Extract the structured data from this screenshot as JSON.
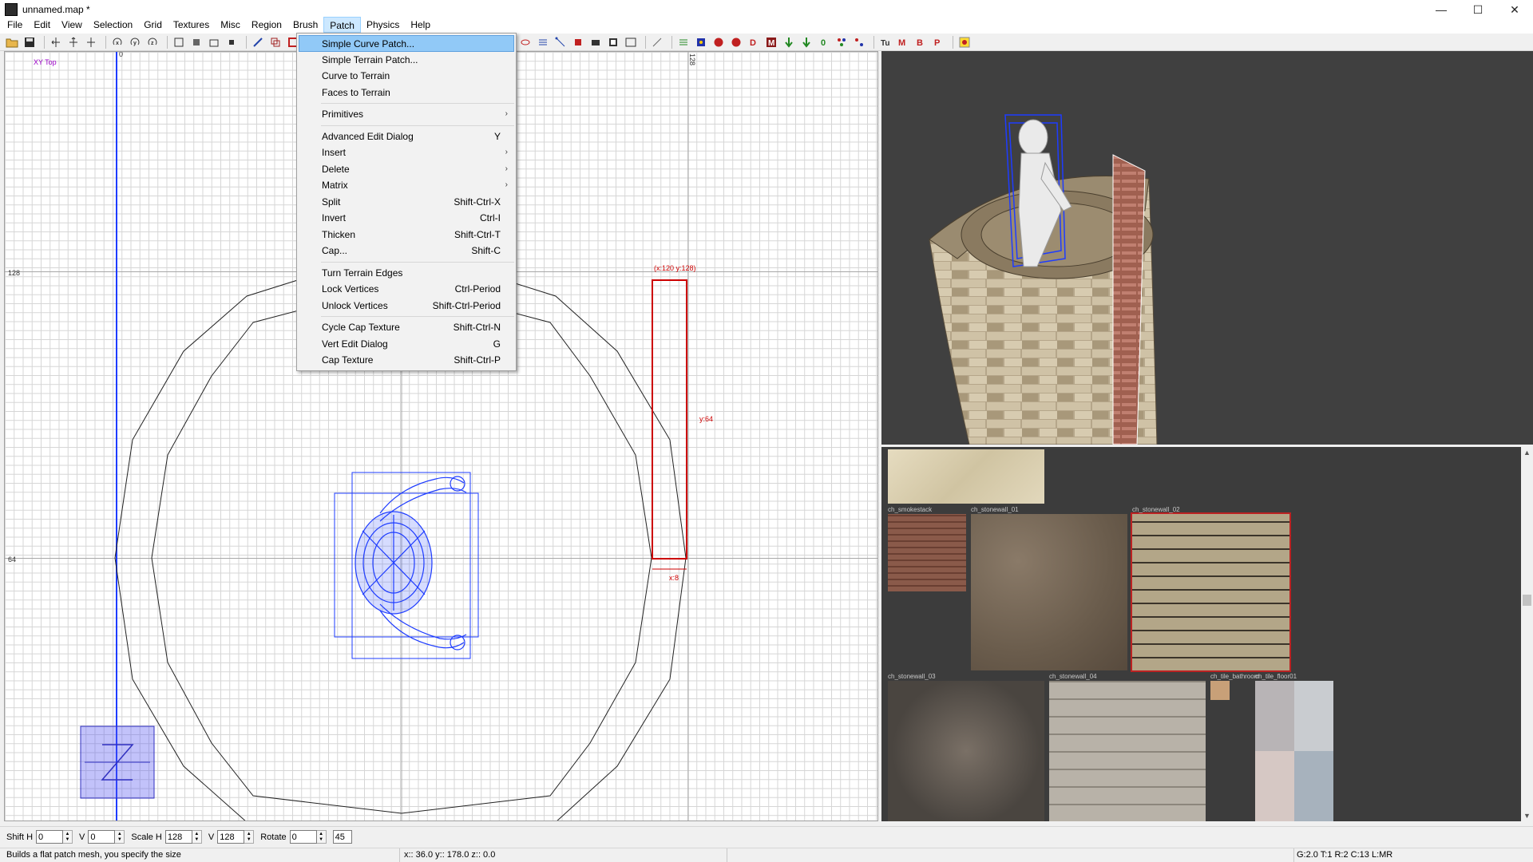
{
  "window": {
    "title": "unnamed.map *",
    "minimize": "—",
    "maximize": "☐",
    "close": "✕"
  },
  "menubar": [
    "File",
    "Edit",
    "View",
    "Selection",
    "Grid",
    "Textures",
    "Misc",
    "Region",
    "Brush",
    "Patch",
    "Physics",
    "Help"
  ],
  "active_menu": "Patch",
  "patch_menu": {
    "simple_curve": "Simple Curve Patch...",
    "simple_terrain": "Simple Terrain Patch...",
    "curve_to_terrain": "Curve to Terrain",
    "faces_to_terrain": "Faces to Terrain",
    "primitives": "Primitives",
    "advanced_edit": "Advanced Edit Dialog",
    "advanced_edit_sc": "Y",
    "insert": "Insert",
    "delete": "Delete",
    "matrix": "Matrix",
    "split": "Split",
    "split_sc": "Shift-Ctrl-X",
    "invert": "Invert",
    "invert_sc": "Ctrl-I",
    "thicken": "Thicken",
    "thicken_sc": "Shift-Ctrl-T",
    "cap": "Cap...",
    "cap_sc": "Shift-C",
    "turn_terrain_edges": "Turn Terrain Edges",
    "lock_vertices": "Lock Vertices",
    "lock_vertices_sc": "Ctrl-Period",
    "unlock_vertices": "Unlock Vertices",
    "unlock_vertices_sc": "Shift-Ctrl-Period",
    "cycle_cap_texture": "Cycle Cap Texture",
    "cycle_cap_texture_sc": "Shift-Ctrl-N",
    "vert_edit_dialog": "Vert Edit Dialog",
    "vert_edit_dialog_sc": "G",
    "cap_texture": "Cap Texture",
    "cap_texture_sc": "Shift-Ctrl-P",
    "submenu_arrow": "›"
  },
  "grid_view": {
    "label": "XY Top",
    "num_128_left": "128",
    "num_64_left": "64",
    "num_128_top": "128",
    "num_0_top": "0",
    "sel_coords": "(x:120  y:128)",
    "sel_y": "y:64",
    "sel_x": "x:8"
  },
  "textures": [
    {
      "name": ""
    },
    {
      "name": "ch_smokestack"
    },
    {
      "name": "ch_stonewall_01"
    },
    {
      "name": "ch_stonewall_02"
    },
    {
      "name": "ch_stonewall_03"
    },
    {
      "name": "ch_stonewall_04"
    },
    {
      "name": "ch_tile_bathroom"
    },
    {
      "name": "ch_tile_floor01"
    }
  ],
  "controls": {
    "shift_h_label": "Shift H",
    "shift_h": "0",
    "shift_v_label": "V",
    "shift_v": "0",
    "scale_h_label": "Scale H",
    "scale_h": "128",
    "scale_v_label": "V",
    "scale_v": "128",
    "rotate_label": "Rotate",
    "rotate": "0",
    "rotate_step": "45"
  },
  "status": {
    "hint": "Builds a flat patch mesh, you specify the size",
    "coords": "x:: 36.0  y:: 178.0  z:: 0.0",
    "grid_info": "G:2.0 T:1 R:2 C:13 L:MR"
  },
  "colors": {
    "menu_highlight": "#91c9f7",
    "selection_red": "#cc0000",
    "model_blue": "#1e3cff",
    "grid_major": "#d6d6d6",
    "camera_bg": "#404040",
    "texture_bg": "#3c3c3c"
  }
}
